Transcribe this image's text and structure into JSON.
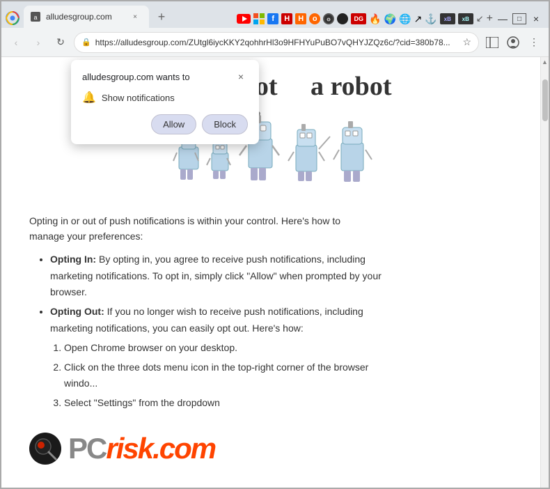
{
  "browser": {
    "tab_label": "alludesgroup.com",
    "url": "https://alludesgroup.com/ZUtgl6iycKKY2qohhrHl3o9HFHYuPuBO7vQHYJZQz6c/?cid=380b78...",
    "back_btn": "‹",
    "forward_btn": "›",
    "reload_btn": "↻",
    "tab_close": "×",
    "new_tab": "+"
  },
  "popup": {
    "title": "alludesgroup.com wants to",
    "close_label": "×",
    "permission_text": "Show notifications",
    "allow_label": "Allow",
    "block_label": "Block"
  },
  "webpage": {
    "title_part1": "you are not",
    "title_part2": "a robot",
    "body_text": "Opting in or out of push notifications is within your control. Here's how to manage your preferences:",
    "bullet1_bold": "Opting In:",
    "bullet1_text": " By opting in, you agree to receive push notifications, including marketing notifications. To opt in, simply click \"Allow\" when prompted by your browser.",
    "bullet2_bold": "Opting Out:",
    "bullet2_text": " If you no longer wish to receive push notifications, including marketing notifications, you can easily opt out. Here's how:",
    "step1": "Open Chrome browser on your desktop.",
    "step2": "Click on the three dots menu icon in the top-right corner of the browser windo...",
    "step3": "Select \"Settings\" from the dropdown"
  },
  "colors": {
    "allow_btn_bg": "#d0d4f0",
    "block_btn_bg": "#d0d4f0",
    "popup_bg": "#ffffff",
    "page_bg": "#ffffff"
  }
}
